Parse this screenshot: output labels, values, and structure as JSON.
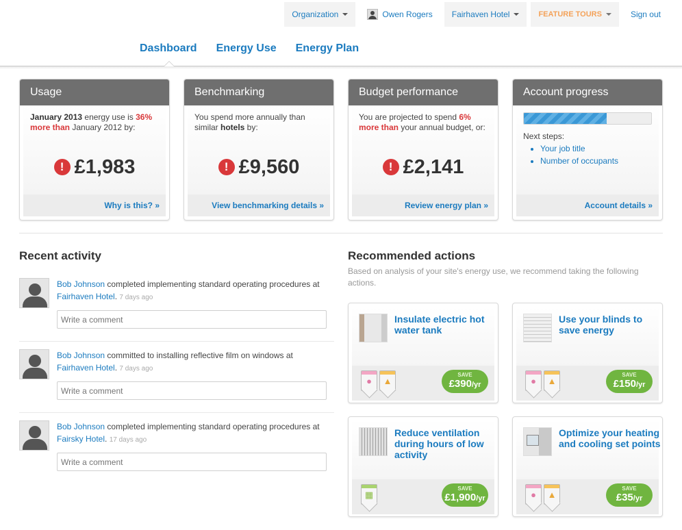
{
  "topbar": {
    "organization": "Organization",
    "user": "Owen Rogers",
    "site": "Fairhaven Hotel",
    "feature_tours": "FEATURE TOURS",
    "sign_out": "Sign out"
  },
  "nav": {
    "dashboard": "Dashboard",
    "energy_use": "Energy Use",
    "energy_plan": "Energy Plan",
    "active": "Dashboard"
  },
  "cards": {
    "usage": {
      "title": "Usage",
      "text_month1": "January 2013",
      "text_mid": " energy use is ",
      "text_pct": "36% more than",
      "text_end": " January 2012 by:",
      "amount": "£1,983",
      "link": "Why is this? »"
    },
    "benchmarking": {
      "title": "Benchmarking",
      "text_start": "You spend more annually than similar ",
      "text_bold": "hotels",
      "text_end": " by:",
      "amount": "£9,560",
      "link": "View benchmarking details »"
    },
    "budget": {
      "title": "Budget performance",
      "text_start": "You are projected to spend ",
      "text_pct": "6% more than",
      "text_end": " your annual budget, or:",
      "amount": "£2,141",
      "link": "Review energy plan »"
    },
    "account": {
      "title": "Account progress",
      "progress": 0.65,
      "next_steps_label": "Next steps:",
      "steps": [
        "Your job title",
        "Number of occupants"
      ],
      "link": "Account details »"
    }
  },
  "recent_activity": {
    "title": "Recent activity",
    "comment_placeholder": "Write a comment",
    "items": [
      {
        "user": "Bob Johnson",
        "action": " completed implementing standard operating procedures at ",
        "place": "Fairhaven Hotel",
        "ago": "7 days ago"
      },
      {
        "user": "Bob Johnson",
        "action": " committed to installing reflective film on windows at ",
        "place": "Fairhaven Hotel",
        "ago": "7 days ago"
      },
      {
        "user": "Bob Johnson",
        "action": " completed implementing standard operating procedures at ",
        "place": "Fairsky Hotel",
        "ago": "17 days ago"
      }
    ]
  },
  "recommended": {
    "title": "Recommended actions",
    "description": "Based on analysis of your site's energy use, we recommend taking the following actions.",
    "save_label": "SAVE",
    "actions": [
      {
        "title": "Insulate electric hot water tank",
        "amount": "£390",
        "per": "/yr"
      },
      {
        "title": "Use your blinds to save energy",
        "amount": "£150",
        "per": "/yr"
      },
      {
        "title": "Reduce ventilation during hours of low activity",
        "amount": "£1,900",
        "per": "/yr"
      },
      {
        "title": "Optimize your heating and cooling set points",
        "amount": "£35",
        "per": "/yr"
      }
    ]
  },
  "colors": {
    "link": "#1b7bbf",
    "card_header": "#6f6f6f",
    "alert": "#d9383a",
    "save_pill": "#70b540",
    "feature_tours": "#f4a259"
  }
}
